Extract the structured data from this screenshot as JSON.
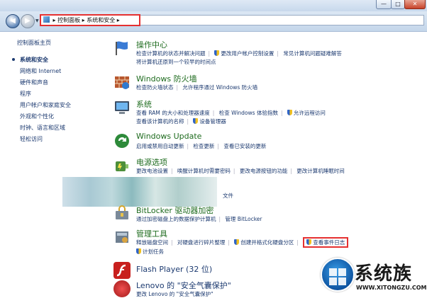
{
  "window": {
    "minimize": "—",
    "maximize": "□",
    "close": "✕"
  },
  "nav": {
    "back": "◀",
    "forward": "▶",
    "breadcrumb": [
      "控制面板",
      "系统和安全"
    ]
  },
  "sidebar": {
    "items": [
      {
        "label": "控制面板主页"
      },
      {
        "label": "系统和安全",
        "current": true
      },
      {
        "label": "网络和 Internet"
      },
      {
        "label": "硬件和声音"
      },
      {
        "label": "程序"
      },
      {
        "label": "用户帐户和家庭安全"
      },
      {
        "label": "外观和个性化"
      },
      {
        "label": "时钟、语言和区域"
      },
      {
        "label": "轻松访问"
      }
    ]
  },
  "sections": {
    "action_center": {
      "title": "操作中心",
      "line1": [
        "检查计算机的状态并解决问题",
        "更改用户帐户控制设置",
        "常见计算机问题疑难解答"
      ],
      "line2": "将计算机还原到一个较早的时间点",
      "icon": "flag-icon"
    },
    "firewall": {
      "title": "Windows 防火墙",
      "line1": [
        "检查防火墙状态",
        "允许程序通过 Windows 防火墙"
      ],
      "icon": "firewall-icon"
    },
    "system": {
      "title": "系统",
      "line1": [
        "查看 RAM 的大小和处理器速度",
        "检查 Windows 体验指数",
        "允许远程访问"
      ],
      "line2": [
        "查看该计算机的名称",
        "设备管理器"
      ],
      "icon": "computer-icon"
    },
    "windows_update": {
      "title": "Windows Update",
      "line1": [
        "启用或禁用自动更新",
        "检查更新",
        "查看已安装的更新"
      ],
      "icon": "update-icon"
    },
    "power": {
      "title": "电源选项",
      "line1": [
        "更改电池设置",
        "唤醒计算机时需要密码",
        "更改电源按钮的功能",
        "更改计算机睡眠时间"
      ],
      "line2_tail": "文件",
      "icon": "power-icon"
    },
    "bitlocker": {
      "title": "BitLocker 驱动器加密",
      "line1": [
        "通过加密磁盘上的数据保护计算机",
        "管理 BitLocker"
      ],
      "icon": "bitlocker-icon"
    },
    "admin_tools": {
      "title": "管理工具",
      "line1": [
        "释放磁盘空间",
        "对硬盘进行碎片整理",
        "创建并格式化硬盘分区",
        "查看事件日志"
      ],
      "line2": "计划任务",
      "icon": "admin-tools-icon"
    },
    "flash": {
      "title": "Flash Player (32 位)",
      "icon": "flash-icon"
    },
    "lenovo": {
      "title": "Lenovo 的 \"安全气囊保护\"",
      "line1": "更改 Lenovo 的 \"安全气囊保护\"",
      "icon": "lenovo-icon"
    }
  },
  "watermark": {
    "text": "系统族",
    "url": "WWW.XITONGZU.COM"
  }
}
